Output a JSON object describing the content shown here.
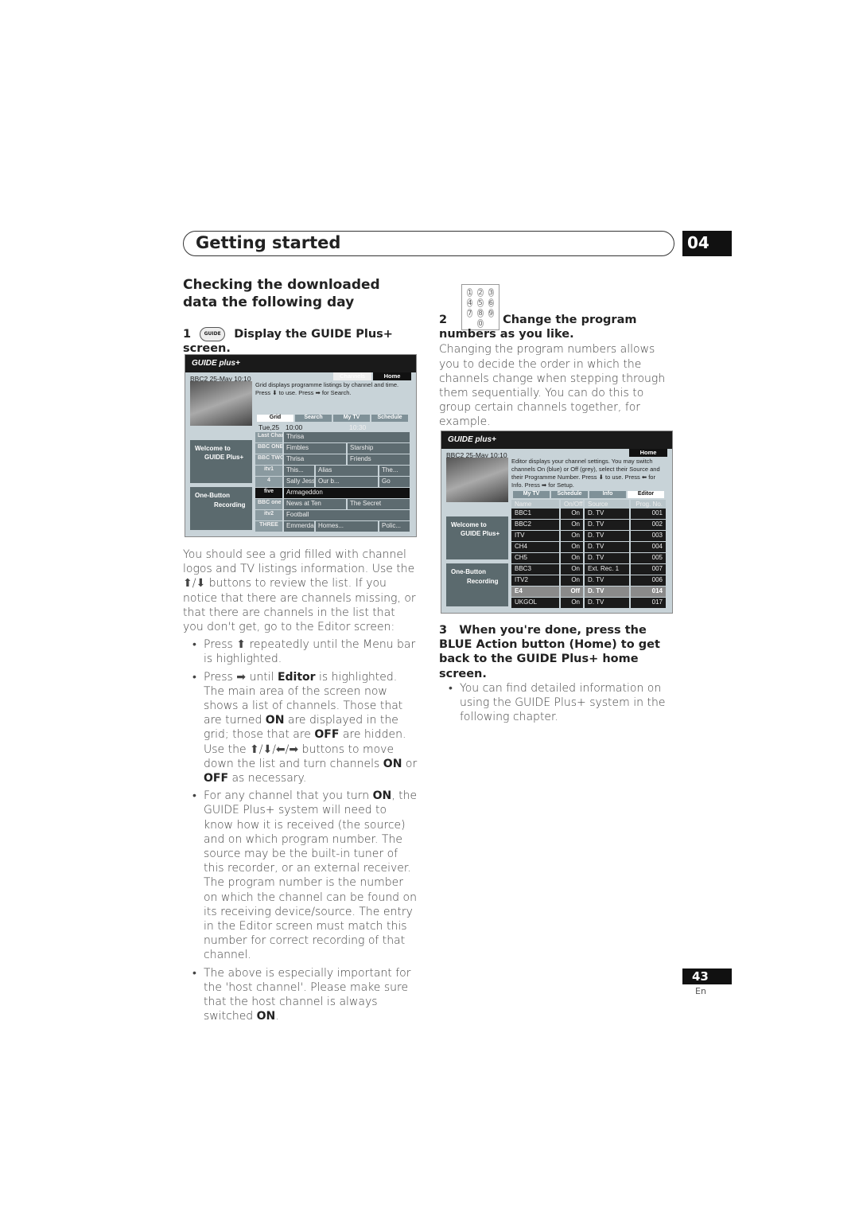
{
  "header": {
    "title": "Getting started",
    "chapter": "04"
  },
  "left": {
    "heading": "Checking the downloaded data the following day",
    "step1_num": "1",
    "step1_icon": "GUIDE",
    "step1_text": "Display the GUIDE Plus+ screen.",
    "para": "You should see a grid filled with channel logos and TV listings information. Use the ⬆/⬇ buttons to review the list. If you notice that there are channels missing, or that there are channels in the list that you don't get, go to the Editor screen:",
    "bullets": [
      [
        "Press ⬆ repeatedly until the Menu bar is highlighted."
      ],
      [
        "Press ➡ until ",
        "Editor",
        " is highlighted. The main area of the screen now shows a list of channels. Those that are turned ",
        "ON",
        " are displayed in the grid; those that are ",
        "OFF",
        " are hidden. Use the ⬆/⬇/⬅/➡ buttons to move down the list and turn channels ",
        "ON",
        " or ",
        "OFF",
        " as necessary."
      ],
      [
        "For any channel that you turn ",
        "ON",
        ", the GUIDE Plus+ system will need to know how it is received (the source) and on which program number. The source may be the built-in tuner of this recorder, or an external receiver. The program number is the number on which the channel can be found on its receiving device/source. The entry in the Editor screen must match this number for correct recording of that channel."
      ],
      [
        "The above is especially important for the 'host channel'. Please make sure that the host channel is always switched ",
        "ON",
        "."
      ]
    ]
  },
  "grid_screen": {
    "logo": "GUIDE plus+",
    "info": "BBC2   25-May  10:10",
    "channels_btn": "Channels",
    "home_btn": "Home",
    "desc": "Grid displays programme listings by channel and time. Press ⬇ to use. Press ➡ for Search.",
    "tabs": [
      "Grid",
      "Search",
      "My TV",
      "Schedule"
    ],
    "date": "Tue,25",
    "t1": "10:00",
    "t2": "10:30",
    "welcome": "Welcome to",
    "guide": "GUIDE Plus+",
    "one_button": "One-Button",
    "recording": "Recording",
    "rows": [
      {
        "logo": "Last Channel",
        "progs": [
          "Thrisa"
        ]
      },
      {
        "logo": "BBC ONE",
        "progs": [
          "Fimbles",
          "Starship"
        ]
      },
      {
        "logo": "BBC TWO",
        "progs": [
          "Thrisa",
          "Friends"
        ]
      },
      {
        "logo": "itv1",
        "progs": [
          "This...",
          "Alias",
          "The..."
        ]
      },
      {
        "logo": "4",
        "progs": [
          "Sally Jessy Raph...",
          "Our b...",
          "Go"
        ]
      },
      {
        "logo": "five",
        "progs": [
          "Armageddon"
        ]
      },
      {
        "logo": "BBC one",
        "progs": [
          "News at Ten",
          "The Secret"
        ]
      },
      {
        "logo": "itv2",
        "progs": [
          "Football"
        ]
      },
      {
        "logo": "THREE",
        "progs": [
          "Emmerdale",
          "Homes...",
          "Polic..."
        ]
      }
    ]
  },
  "right": {
    "keypad": [
      "1",
      "2",
      "3",
      "4",
      "5",
      "6",
      "7",
      "8",
      "9",
      "0"
    ],
    "step2_num": "2",
    "step2_text": "Change the program numbers as you like.",
    "step2_para": "Changing the program numbers allows you to decide the order in which the channels change when stepping through them sequentially. You can do this to group certain channels together, for example.",
    "step3_num": "3",
    "step3_text": "When you're done, press the BLUE Action button (Home) to get back to the GUIDE Plus+ home screen.",
    "step3_bullet": "You can find detailed information on using the GUIDE Plus+ system in the following chapter."
  },
  "editor_screen": {
    "logo": "GUIDE plus+",
    "info": "BBC2   25-May  10:10",
    "home_btn": "Home",
    "desc": "Editor displays your channel settings. You may switch channels On (blue) or Off (grey), select their Source and their Programme Number. Press ⬇ to use. Press ⬅ for Info. Press ➡ for Setup.",
    "tabs": [
      "My TV",
      "Schedule",
      "Info",
      "Editor"
    ],
    "columns": [
      "Name",
      "On/Off",
      "Source",
      "Prog. No."
    ],
    "welcome": "Welcome to",
    "guide": "GUIDE Plus+",
    "one_button": "One-Button",
    "recording": "Recording",
    "rows": [
      [
        "BBC1",
        "On",
        "D. TV",
        "001"
      ],
      [
        "BBC2",
        "On",
        "D. TV",
        "002"
      ],
      [
        "ITV",
        "On",
        "D. TV",
        "003"
      ],
      [
        "CH4",
        "On",
        "D. TV",
        "004"
      ],
      [
        "CH5",
        "On",
        "D. TV",
        "005"
      ],
      [
        "BBC3",
        "On",
        "Ext. Rec. 1",
        "007"
      ],
      [
        "ITV2",
        "On",
        "D. TV",
        "006"
      ],
      [
        "E4",
        "Off",
        "D. TV",
        "014"
      ],
      [
        "UKGOL",
        "On",
        "D. TV",
        "017"
      ]
    ]
  },
  "footer": {
    "page": "43",
    "lang": "En"
  }
}
